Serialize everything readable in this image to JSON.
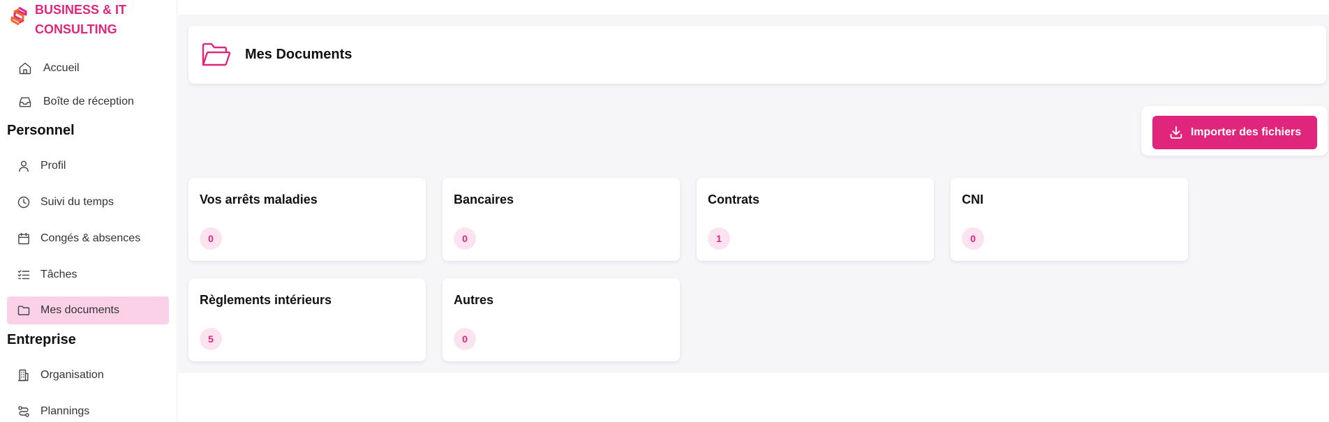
{
  "brand": {
    "line1": "BUSINESS & IT",
    "line2": "CONSULTING"
  },
  "sidebar": {
    "top_items": [
      {
        "label": "Accueil",
        "icon": "home-icon"
      },
      {
        "label": "Boîte de réception",
        "icon": "inbox-icon"
      }
    ],
    "personnel": {
      "title": "Personnel",
      "items": [
        {
          "label": "Profil",
          "icon": "user-icon"
        },
        {
          "label": "Suivi du temps",
          "icon": "clock-icon"
        },
        {
          "label": "Congés & absences",
          "icon": "calendar-icon"
        },
        {
          "label": "Tâches",
          "icon": "tasks-icon"
        },
        {
          "label": "Mes documents",
          "icon": "folder-icon",
          "active": true
        }
      ]
    },
    "entreprise": {
      "title": "Entreprise",
      "items": [
        {
          "label": "Organisation",
          "icon": "building-icon"
        },
        {
          "label": "Plannings",
          "icon": "route-icon"
        }
      ]
    }
  },
  "header": {
    "title": "Mes Documents",
    "icon": "folder-open-icon"
  },
  "import_button": {
    "label": "Importer des fichiers",
    "icon": "download-icon"
  },
  "categories": [
    {
      "title": "Vos arrêts maladies",
      "count": "0"
    },
    {
      "title": "Bancaires",
      "count": "0"
    },
    {
      "title": "Contrats",
      "count": "1"
    },
    {
      "title": "CNI",
      "count": "0"
    },
    {
      "title": "Règlements intérieurs",
      "count": "5"
    },
    {
      "title": "Autres",
      "count": "0"
    }
  ],
  "colors": {
    "accent": "#e0267c",
    "active_bg": "#fbd1e7",
    "badge_bg": "#fde3ef",
    "main_bg": "#f6f6f9"
  }
}
